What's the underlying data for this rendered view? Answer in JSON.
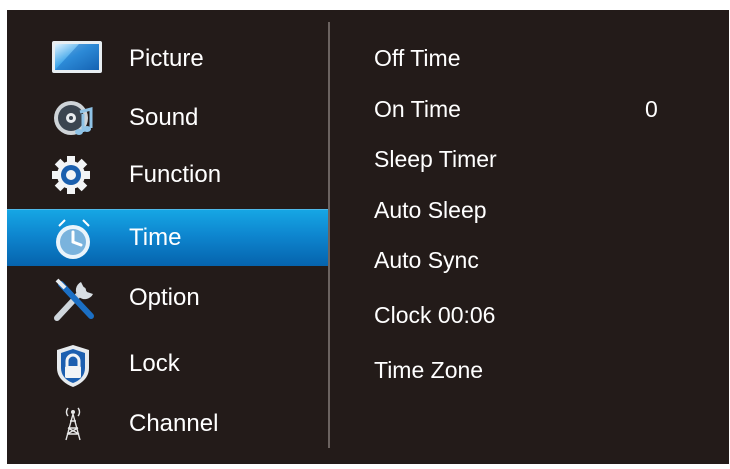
{
  "sidebar": {
    "items": [
      {
        "label": "Picture",
        "icon": "picture-icon"
      },
      {
        "label": "Sound",
        "icon": "sound-icon"
      },
      {
        "label": "Function",
        "icon": "function-gear-icon"
      },
      {
        "label": "Time",
        "icon": "clock-icon"
      },
      {
        "label": "Option",
        "icon": "tools-icon"
      },
      {
        "label": "Lock",
        "icon": "lock-icon"
      },
      {
        "label": "Channel",
        "icon": "antenna-icon"
      }
    ],
    "selected": "Time"
  },
  "time_menu": {
    "off_time": {
      "label": "Off Time"
    },
    "on_time": {
      "label": "On Time",
      "value": "0"
    },
    "sleep_timer": {
      "label": "Sleep Timer"
    },
    "auto_sleep": {
      "label": "Auto Sleep"
    },
    "auto_sync": {
      "label": "Auto Sync"
    },
    "clock": {
      "label": "Clock 00:06"
    },
    "time_zone": {
      "label": "Time Zone"
    }
  },
  "colors": {
    "background": "#231b19",
    "selection": "#0e86cf",
    "text": "#ffffff"
  }
}
